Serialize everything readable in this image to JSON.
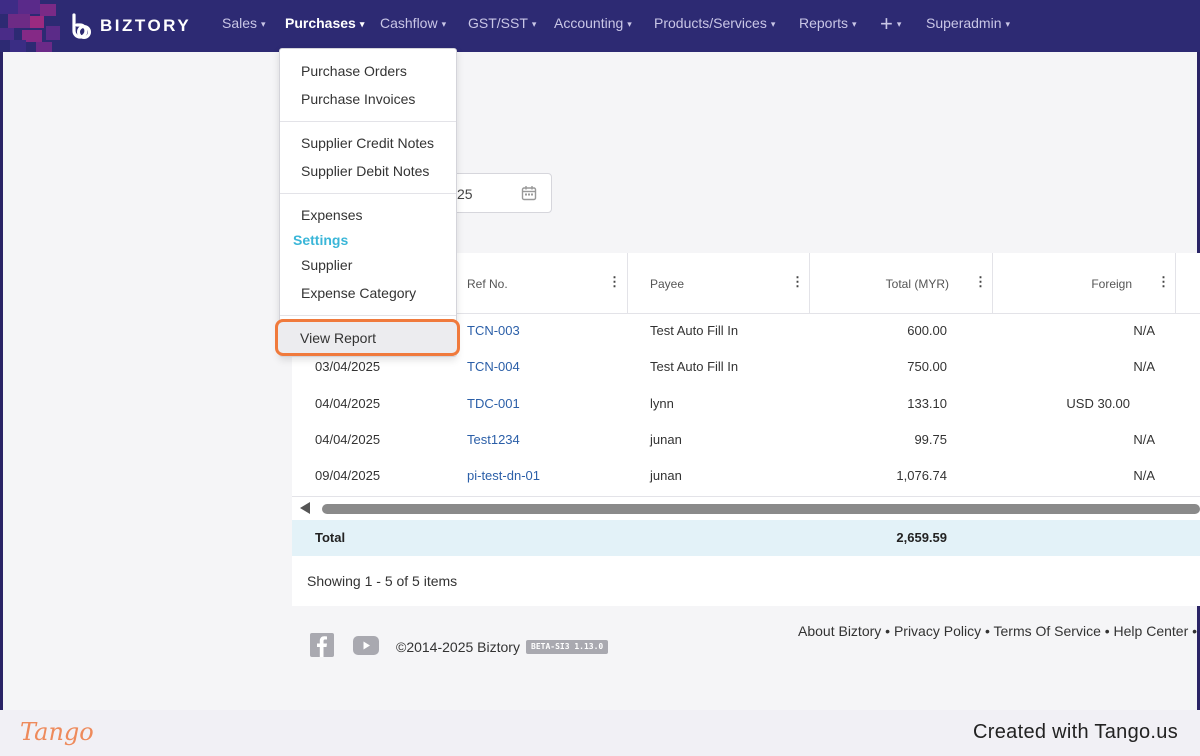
{
  "nav": {
    "brand": "BIZTORY",
    "items": [
      {
        "label": "Sales"
      },
      {
        "label": "Purchases"
      },
      {
        "label": "Cashflow"
      },
      {
        "label": "GST/SST"
      },
      {
        "label": "Accounting"
      },
      {
        "label": "Products/Services"
      },
      {
        "label": "Reports"
      },
      {
        "label": "+"
      },
      {
        "label": "Superadmin"
      }
    ],
    "active": "Purchases",
    "caret": "▾"
  },
  "dropdown": {
    "group1": [
      "Purchase Orders",
      "Purchase Invoices"
    ],
    "group2": [
      "Supplier Credit Notes",
      "Supplier Debit Notes"
    ],
    "expenses": "Expenses",
    "settings_heading": "Settings",
    "settings_items": [
      "Supplier",
      "Expense Category"
    ],
    "view_report": "View Report",
    "highlight_color": "#f07a3c",
    "heading_color": "#3ab6d8"
  },
  "date_field": {
    "value": "25",
    "icon": "calendar-icon"
  },
  "table": {
    "columns": [
      "Ref No.",
      "Payee",
      "Total (MYR)",
      "Foreign"
    ],
    "rows": [
      {
        "date": "",
        "ref": "TCN-003",
        "payee": "Test Auto Fill In",
        "total": "600.00",
        "foreign": "N/A"
      },
      {
        "date": "03/04/2025",
        "ref": "TCN-004",
        "payee": "Test Auto Fill In",
        "total": "750.00",
        "foreign": "N/A"
      },
      {
        "date": "04/04/2025",
        "ref": "TDC-001",
        "payee": "lynn",
        "total": "133.10",
        "foreign": "USD 30.00"
      },
      {
        "date": "04/04/2025",
        "ref": "Test1234",
        "payee": "junan",
        "total": "99.75",
        "foreign": "N/A"
      },
      {
        "date": "09/04/2025",
        "ref": "pi-test-dn-01",
        "payee": "junan",
        "total": "1,076.74",
        "foreign": "N/A"
      }
    ],
    "total_label": "Total",
    "total_value": "2,659.59",
    "kebab": "⋮",
    "showing": "Showing 1 - 5 of 5 items"
  },
  "footer": {
    "links": "About Biztory • Privacy Policy • Terms Of Service • Help Center •",
    "copyright": "©2014-2025 Biztory",
    "version": "BETA-SI3 1.13.0"
  },
  "tango": {
    "logo": "Tango",
    "credit": "Created with Tango.us"
  },
  "colors": {
    "nav_bg": "#2d2a73",
    "link": "#2b5fa8",
    "total_row_bg": "#e3f2f8"
  }
}
